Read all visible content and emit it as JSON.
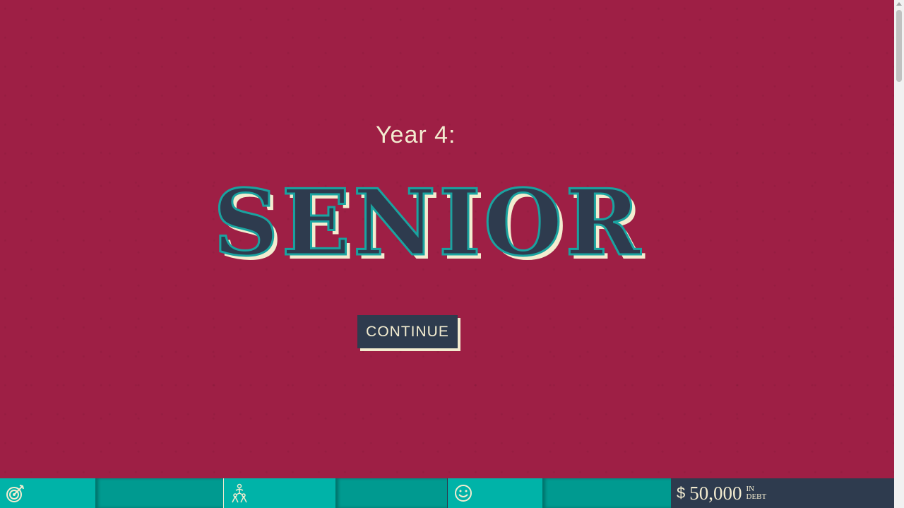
{
  "screen": {
    "year_label": "Year 4:",
    "title": "SENIOR",
    "continue_label": "CONTINUE"
  },
  "statusbar": {
    "icons": [
      "target-icon",
      "people-icon",
      "smiley-icon"
    ],
    "currency_symbol": "$",
    "debt_amount": "50,000",
    "debt_in": "IN",
    "debt_label": "DEBT"
  },
  "colors": {
    "background": "#9e1f45",
    "title_fill": "#2e3b4e",
    "title_outline": "#1aa3a0",
    "cream": "#f3ecd0",
    "teal": "#00b3a8",
    "teal_dark": "#009a90",
    "navy": "#2e3b4e"
  }
}
